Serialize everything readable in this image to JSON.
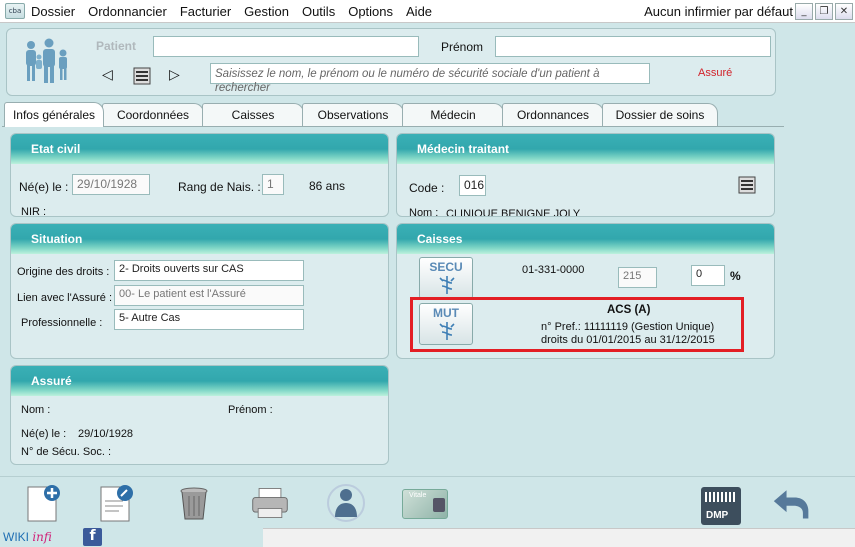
{
  "menu": {
    "app_icon": "cba",
    "items": [
      "Dossier",
      "Ordonnancier",
      "Facturier",
      "Gestion",
      "Outils",
      "Options",
      "Aide"
    ],
    "right_text": "Aucun infirmier par défaut"
  },
  "patient": {
    "patient_label": "Patient",
    "prenom_label": "Prénom",
    "patient_value": "",
    "prenom_value": "",
    "search_placeholder": "Saisissez le nom, le prénom ou le numéro de sécurité sociale d'un patient à rechercher",
    "assure_label": "Assuré"
  },
  "tabs": [
    "Infos générales",
    "Coordonnées",
    "Caisses",
    "Observations",
    "Médecin",
    "Ordonnances",
    "Dossier de soins"
  ],
  "etat_civil": {
    "title": "Etat civil",
    "ne_label": "Né(e) le :",
    "ne_value": "29/10/1928",
    "rang_label": "Rang de Nais. :",
    "rang_value": "1",
    "age": "86 ans",
    "nir_label": "NIR :"
  },
  "medecin": {
    "title": "Médecin traitant",
    "code_label": "Code :",
    "code_value": "016",
    "nom_label": "Nom :",
    "nom_value": "CLINIQUE BENIGNE JOLY"
  },
  "situation": {
    "title": "Situation",
    "origine_label": "Origine des droits :",
    "origine_value": "2- Droits ouverts sur CAS",
    "lien_label": "Lien avec l'Assuré :",
    "lien_value": "00- Le patient est l'Assuré",
    "pro_label": "Professionnelle :",
    "pro_value": "5- Autre Cas"
  },
  "caisses": {
    "title": "Caisses",
    "secu_label": "SECU",
    "secu_code": "01-331-0000",
    "secu_num": "215",
    "percent_value": "0",
    "percent_sign": "%",
    "mut_label": "MUT",
    "mut_name": "ACS (A)",
    "mut_pref": "n° Pref.: 11111119 (Gestion Unique)",
    "mut_droits": "droits du 01/01/2015 au 31/12/2015"
  },
  "assure": {
    "title": "Assuré",
    "nom_label": "Nom :",
    "prenom_label": "Prénom :",
    "ne_label": "Né(e) le :",
    "ne_value": "29/10/1928",
    "secu_label": "N° de Sécu. Soc. :"
  },
  "toolbar": {
    "icons": [
      "new-document-icon",
      "edit-document-icon",
      "trash-icon",
      "printer-icon",
      "person-icon",
      "vitale-card-icon",
      "dmp-icon",
      "back-arrow-icon"
    ],
    "dmp_label": "DMP",
    "vitale_label": "Vitale"
  },
  "status": {
    "wiki": "WIKI",
    "infi": "infi",
    "fb": "f"
  }
}
